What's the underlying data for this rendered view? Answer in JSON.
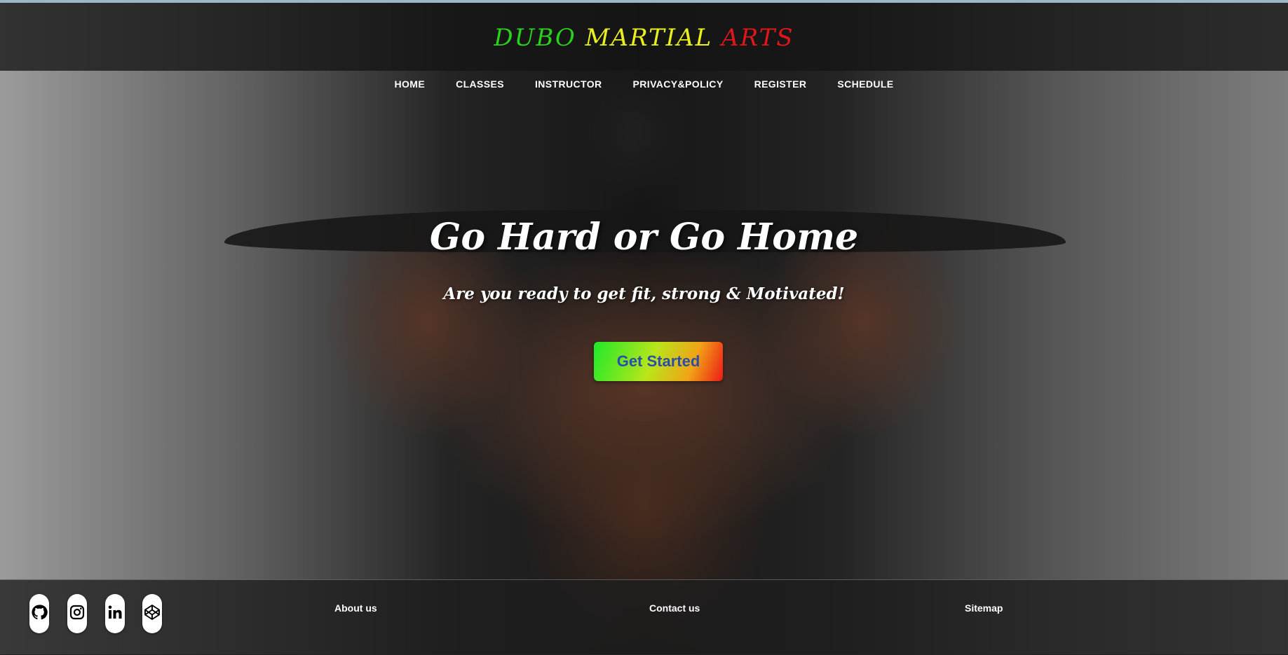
{
  "brand": {
    "word1": "DUBO",
    "word2": "MARTIAL",
    "word3": "ARTS",
    "colors": {
      "word1": "#27d11c",
      "word2": "#e8ef1c",
      "word3": "#e0161a"
    }
  },
  "nav": {
    "items": [
      {
        "label": "HOME"
      },
      {
        "label": "CLASSES"
      },
      {
        "label": "INSTRUCTOR"
      },
      {
        "label": "PRIVACY&POLICY"
      },
      {
        "label": "REGISTER"
      },
      {
        "label": "SCHEDULE"
      }
    ]
  },
  "hero": {
    "headline": "Go Hard or Go Home",
    "subhead": "Are you ready to get fit, strong & Motivated!",
    "cta_label": "Get Started"
  },
  "footer": {
    "social": [
      {
        "icon": "github-icon"
      },
      {
        "icon": "instagram-icon"
      },
      {
        "icon": "linkedin-icon"
      },
      {
        "icon": "codepen-icon"
      }
    ],
    "links": {
      "about": "About us",
      "contact": "Contact us",
      "sitemap": "Sitemap"
    }
  }
}
